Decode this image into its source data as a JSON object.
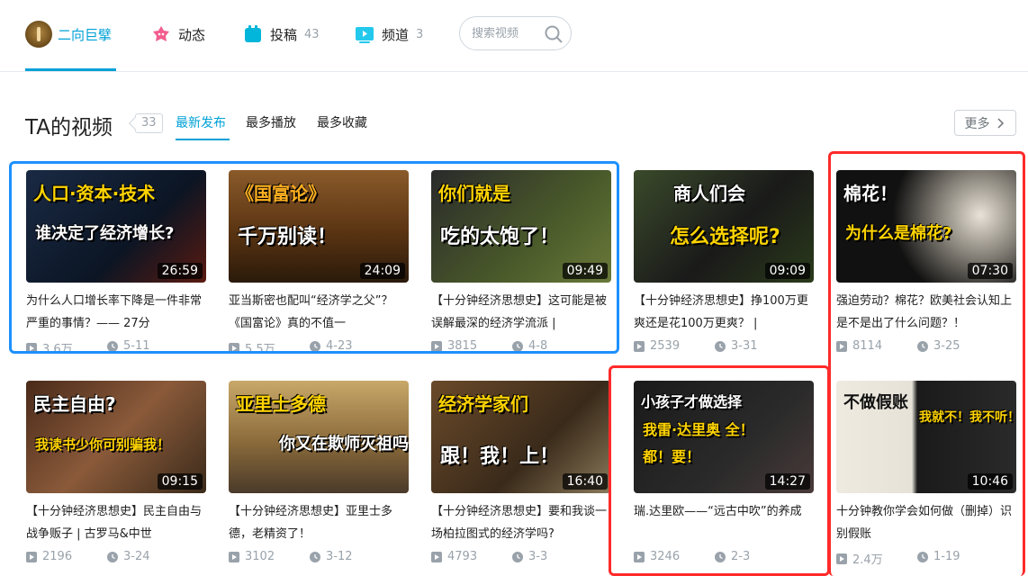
{
  "nav": {
    "home_label": "二向巨擘",
    "dynamic_label": "动态",
    "uploads_label": "投稿",
    "uploads_count": "43",
    "channels_label": "频道",
    "channels_count": "3",
    "search_placeholder": "搜索视频",
    "accent_color": "#00a1d6"
  },
  "section": {
    "title": "TA的视频",
    "count": "33",
    "tabs": [
      "最新发布",
      "最多播放",
      "最多收藏"
    ],
    "active_tab": "最新发布",
    "more_label": "更多"
  },
  "videos": [
    {
      "thumb_text1": "人口·资本·技术",
      "thumb_text2": "谁决定了经济增长?",
      "duration": "26:59",
      "title": "为什么人口增长率下降是一件非常严重的事情？—— 27分",
      "plays": "3.6万",
      "date": "5-11"
    },
    {
      "thumb_text1": "《国富论》",
      "thumb_text2": "千万别读！",
      "duration": "24:09",
      "title": "亚当斯密也配叫“经济学之父”？《国富论》真的不值一",
      "plays": "5.5万",
      "date": "4-23"
    },
    {
      "thumb_text1": "你们就是",
      "thumb_text2": "吃的太饱了！",
      "duration": "09:49",
      "title": "【十分钟经济思想史】这可能是被误解最深的经济学流派 |",
      "plays": "3815",
      "date": "4-8"
    },
    {
      "thumb_text1": "商人们会",
      "thumb_text2": "怎么选择呢?",
      "duration": "09:09",
      "title": "【十分钟经济思想史】挣100万更爽还是花100万更爽？ |",
      "plays": "2539",
      "date": "3-31"
    },
    {
      "thumb_text1": "棉花！",
      "thumb_text2": "为什么是棉花?",
      "duration": "07:30",
      "title": "强迫劳动？棉花？欧美社会认知上是不是出了什么问题？！",
      "plays": "8114",
      "date": "3-25"
    },
    {
      "thumb_text1": "民主自由?",
      "thumb_text2": "我读书少你可别骗我！",
      "duration": "09:15",
      "title": "【十分钟经济思想史】民主自由与战争贩子 | 古罗马&中世",
      "plays": "2196",
      "date": "3-24"
    },
    {
      "thumb_text1": "亚里士多德",
      "thumb_text2": "你又在欺师灭祖吗!",
      "duration": "",
      "title": "【十分钟经济思想史】亚里士多德，老精资了！",
      "plays": "3102",
      "date": "3-12"
    },
    {
      "thumb_text1": "经济学家们",
      "thumb_text2": "跟！我！上！",
      "duration": "16:40",
      "title": "【十分钟经济思想史】要和我谈一场柏拉图式的经济学吗?",
      "plays": "4793",
      "date": "3-3"
    },
    {
      "thumb_text1": "小孩子才做选择",
      "thumb_text2": "我雷·达里奥 全！都！要！",
      "duration": "14:27",
      "title": "瑞.达里欧——“远古中吹”的养成",
      "plays": "3246",
      "date": "2-3"
    },
    {
      "thumb_text1": "不做假账",
      "thumb_text2": "我就不！我不听！",
      "duration": "10:46",
      "title": "十分钟教你学会如何做（删掉）识别假账",
      "plays": "2.4万",
      "date": "1-19"
    }
  ]
}
